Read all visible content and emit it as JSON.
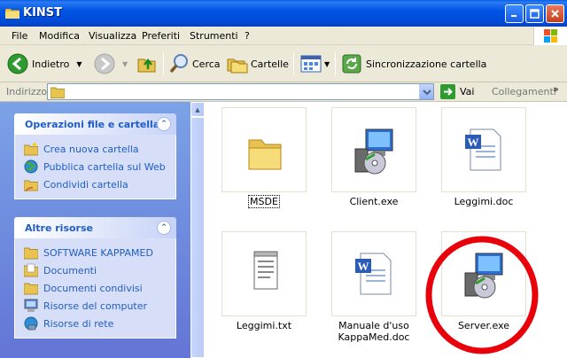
{
  "window": {
    "title": "KINST"
  },
  "menu": [
    "File",
    "Modifica",
    "Visualizza",
    "Preferiti",
    "Strumenti",
    "?"
  ],
  "toolbar": {
    "back": "Indietro",
    "search": "Cerca",
    "folders": "Cartelle",
    "sync": "Sincronizzazione cartella"
  },
  "address": {
    "label": "Indirizzo",
    "value": "",
    "go": "Vai",
    "links": "Collegamenti"
  },
  "tasks": {
    "file_ops": {
      "title": "Operazioni file e cartella",
      "items": [
        "Crea nuova cartella",
        "Pubblica cartella sul Web",
        "Condividi cartella"
      ]
    },
    "other": {
      "title": "Altre risorse",
      "items": [
        "SOFTWARE KAPPAMED",
        "Documenti",
        "Documenti condivisi",
        "Risorse del computer",
        "Risorse di rete"
      ]
    }
  },
  "files": [
    {
      "name": "MSDE",
      "icon": "folder-icon"
    },
    {
      "name": "Client.exe",
      "icon": "installer-icon"
    },
    {
      "name": "Leggimi.doc",
      "icon": "word-document-icon"
    },
    {
      "name": "Leggimi.txt",
      "icon": "text-file-icon"
    },
    {
      "name": "Manuale d'uso KappaMed.doc",
      "icon": "word-document-icon"
    },
    {
      "name": "Server.exe",
      "icon": "installer-icon"
    }
  ],
  "colors": {
    "highlight_circle": "#e8000b",
    "title_bar": "#0054e3",
    "task_link": "#215dc6"
  }
}
